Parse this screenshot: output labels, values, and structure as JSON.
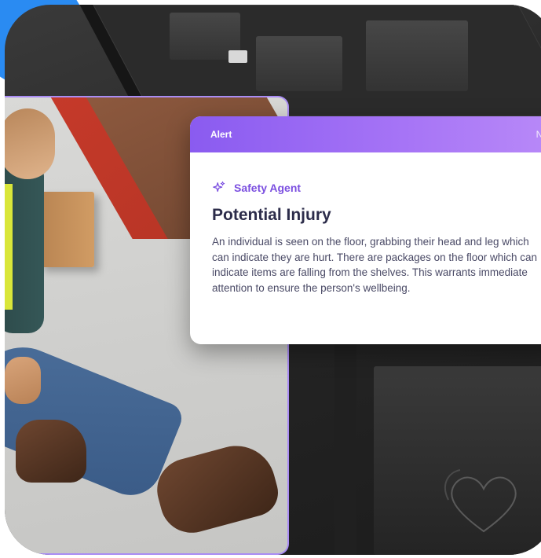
{
  "alert": {
    "header_label": "Alert",
    "header_right": "No",
    "agent_label": "Safety Agent",
    "title": "Potential Injury",
    "body": "An individual is seen on the floor, grabbing their head and leg which can indicate they are hurt. There are packages on the floor which can indicate items are falling from the shelves. This warrants immediate attention to ensure the person's wellbeing."
  },
  "icons": {
    "agent_icon": "sparkle-icon"
  },
  "colors": {
    "accent_blue": "#2a8bf2",
    "header_gradient_start": "#8a5bf0",
    "header_gradient_end": "#b98af8",
    "agent_text": "#7b4fe0",
    "photo_border": "#a98cf4"
  }
}
